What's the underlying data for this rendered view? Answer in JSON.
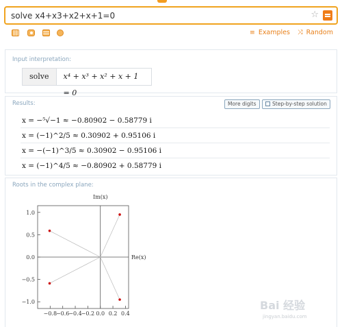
{
  "search": {
    "value": "solve x4+x3+x2+x+1=0"
  },
  "toolbar": {
    "examples": "Examples",
    "random": "Random"
  },
  "interpretation": {
    "title": "Input interpretation:",
    "command": "solve",
    "equation": "x⁴ + x³ + x² + x + 1 = 0"
  },
  "results": {
    "title": "Results:",
    "more_digits": "More digits",
    "step_by_step": "Step-by-step solution",
    "rows": [
      "x = −⁵√−1 ≈ −0.80902 − 0.58779 i",
      "x = (−1)^2/5 ≈ 0.30902 + 0.95106 i",
      "x = −(−1)^3/5 ≈ 0.30902 − 0.95106 i",
      "x = (−1)^4/5 ≈ −0.80902 + 0.58779 i"
    ]
  },
  "roots_plot": {
    "title": "Roots in the complex plane:",
    "chart_data": {
      "type": "scatter",
      "xlabel": "Re(x)",
      "ylabel": "Im(x)",
      "xlim": [
        -1.0,
        0.45
      ],
      "ylim": [
        -1.15,
        1.15
      ],
      "x_ticks": [
        "−0.8",
        "−0.6",
        "−0.4",
        "−0.2",
        "0.0",
        "0.2",
        "0.4"
      ],
      "x_tick_values": [
        -0.8,
        -0.6,
        -0.4,
        -0.2,
        0.0,
        0.2,
        0.4
      ],
      "y_ticks": [
        "1.0",
        "0.5",
        "0.0",
        "−0.5",
        "−1.0"
      ],
      "y_tick_values": [
        1.0,
        0.5,
        0.0,
        -0.5,
        -1.0
      ],
      "points": [
        {
          "re": -0.80902,
          "im": -0.58779
        },
        {
          "re": 0.30902,
          "im": 0.95106
        },
        {
          "re": 0.30902,
          "im": -0.95106
        },
        {
          "re": -0.80902,
          "im": 0.58779
        }
      ],
      "point_color": "#cc1111"
    }
  },
  "watermark": {
    "main": "Bai 经验",
    "sub": "jingyan.baidu.com"
  }
}
